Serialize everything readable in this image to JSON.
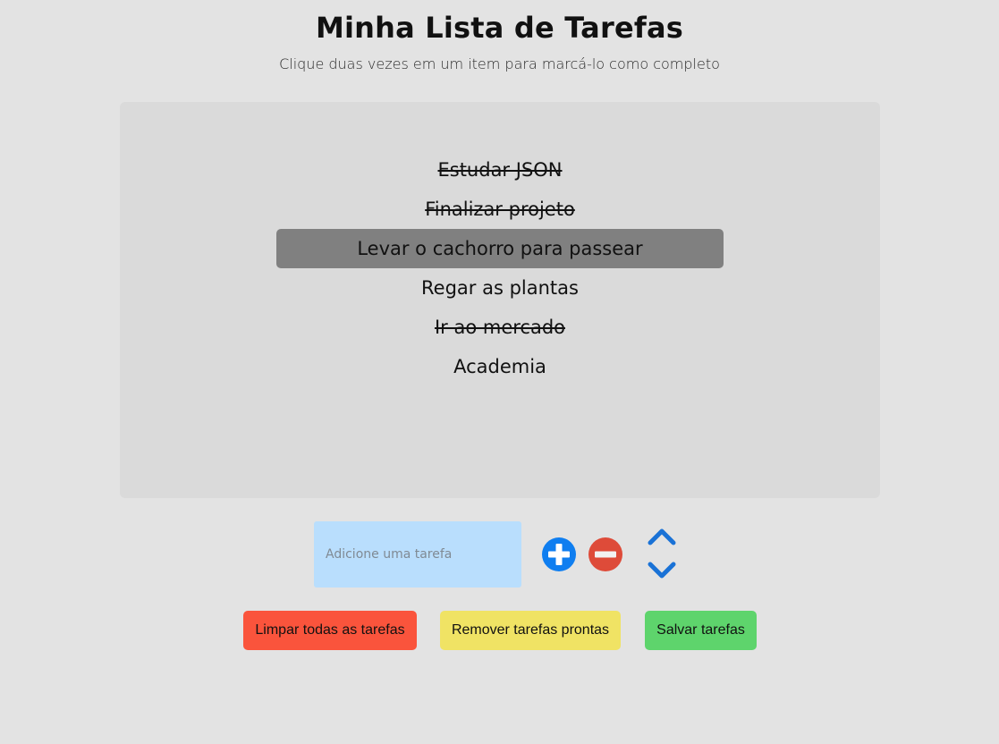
{
  "header": {
    "title": "Minha Lista de Tarefas",
    "subtitle": "Clique duas vezes em um item para marcá-lo como completo"
  },
  "tasks": [
    {
      "label": "Estudar JSON",
      "completed": true,
      "selected": false
    },
    {
      "label": "Finalizar projeto",
      "completed": true,
      "selected": false
    },
    {
      "label": "Levar o cachorro para passear",
      "completed": false,
      "selected": true
    },
    {
      "label": "Regar as plantas",
      "completed": false,
      "selected": false
    },
    {
      "label": "Ir ao mercado",
      "completed": true,
      "selected": false
    },
    {
      "label": "Academia",
      "completed": false,
      "selected": false
    }
  ],
  "input": {
    "value": "",
    "placeholder": "Adicione uma tarefa"
  },
  "controls": {
    "add_icon": "plus-circle-icon",
    "remove_icon": "minus-circle-icon",
    "up_icon": "chevron-up-icon",
    "down_icon": "chevron-down-icon"
  },
  "actions": {
    "clear_all_label": "Limpar todas as tarefas",
    "remove_done_label": "Remover tarefas prontas",
    "save_label": "Salvar tarefas"
  },
  "colors": {
    "background": "#e3e3e3",
    "panel": "#dadada",
    "selected_row": "#808080",
    "input_bg": "#b9defd",
    "add_blue": "#0f7ef0",
    "remove_red": "#de4b39",
    "arrow_blue": "#1a72d6",
    "clear_red": "#fa543c",
    "remove_done_yellow": "#f0e364",
    "save_green": "#5ed46c"
  }
}
